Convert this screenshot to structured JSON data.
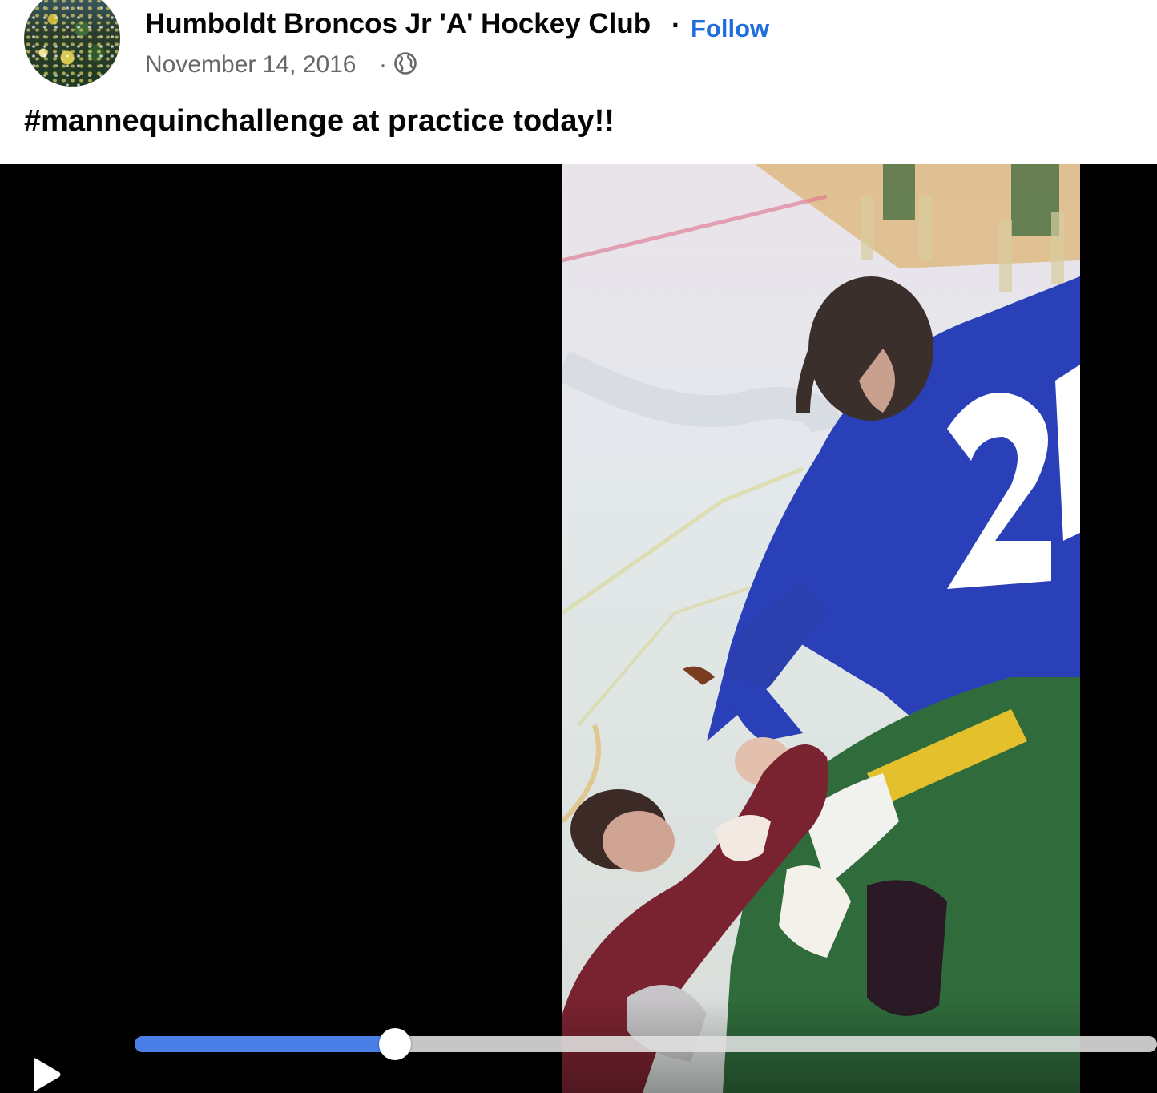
{
  "post": {
    "page_name": "Humboldt Broncos Jr 'A' Hockey Club",
    "separator": "·",
    "follow_label": "Follow",
    "date": "November 14, 2016",
    "date_separator": "·",
    "audience_icon": "globe-icon",
    "text": "#mannequinchallenge at practice today!!"
  },
  "video": {
    "play_icon": "play-icon",
    "progress": 0.255
  },
  "colors": {
    "link": "#216fdb",
    "progress_fill": "#4a7fe8",
    "secondary_text": "#65676b"
  }
}
